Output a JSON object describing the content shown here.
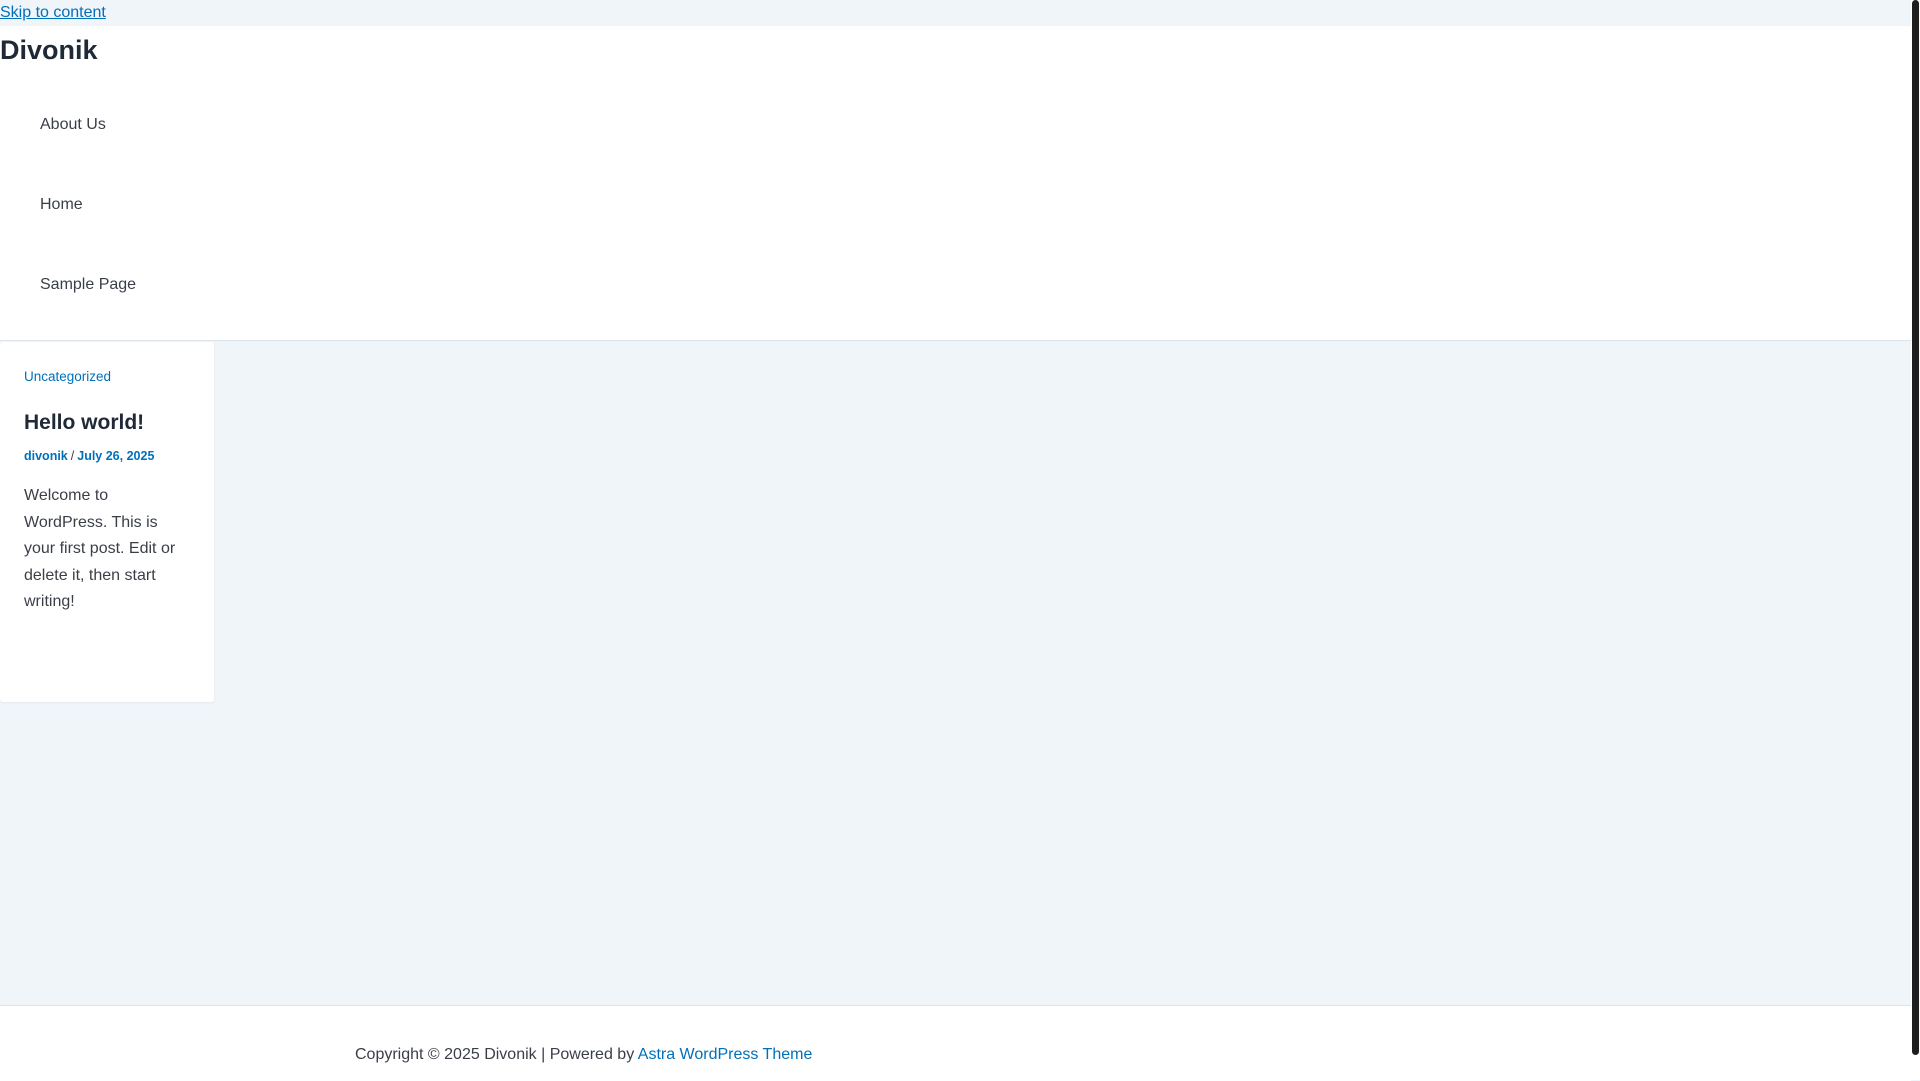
{
  "skip_link": "Skip to content",
  "site_title": "Divonik",
  "nav": {
    "items": [
      {
        "label": "About Us"
      },
      {
        "label": "Home"
      },
      {
        "label": "Sample Page"
      }
    ]
  },
  "post": {
    "category": "Uncategorized",
    "title": "Hello world!",
    "author": "divonik",
    "separator": "/",
    "date": "July 26, 2025",
    "excerpt": "Welcome to WordPress. This is your first post. Edit or delete it, then start writing!"
  },
  "footer": {
    "copyright": "Copyright © 2025 Divonik | Powered by ",
    "theme_link": "Astra WordPress Theme"
  },
  "colors": {
    "accent": "#0170b9",
    "background": "#f0f5fa",
    "text": "#3a3f47",
    "heading": "#1f2937"
  }
}
